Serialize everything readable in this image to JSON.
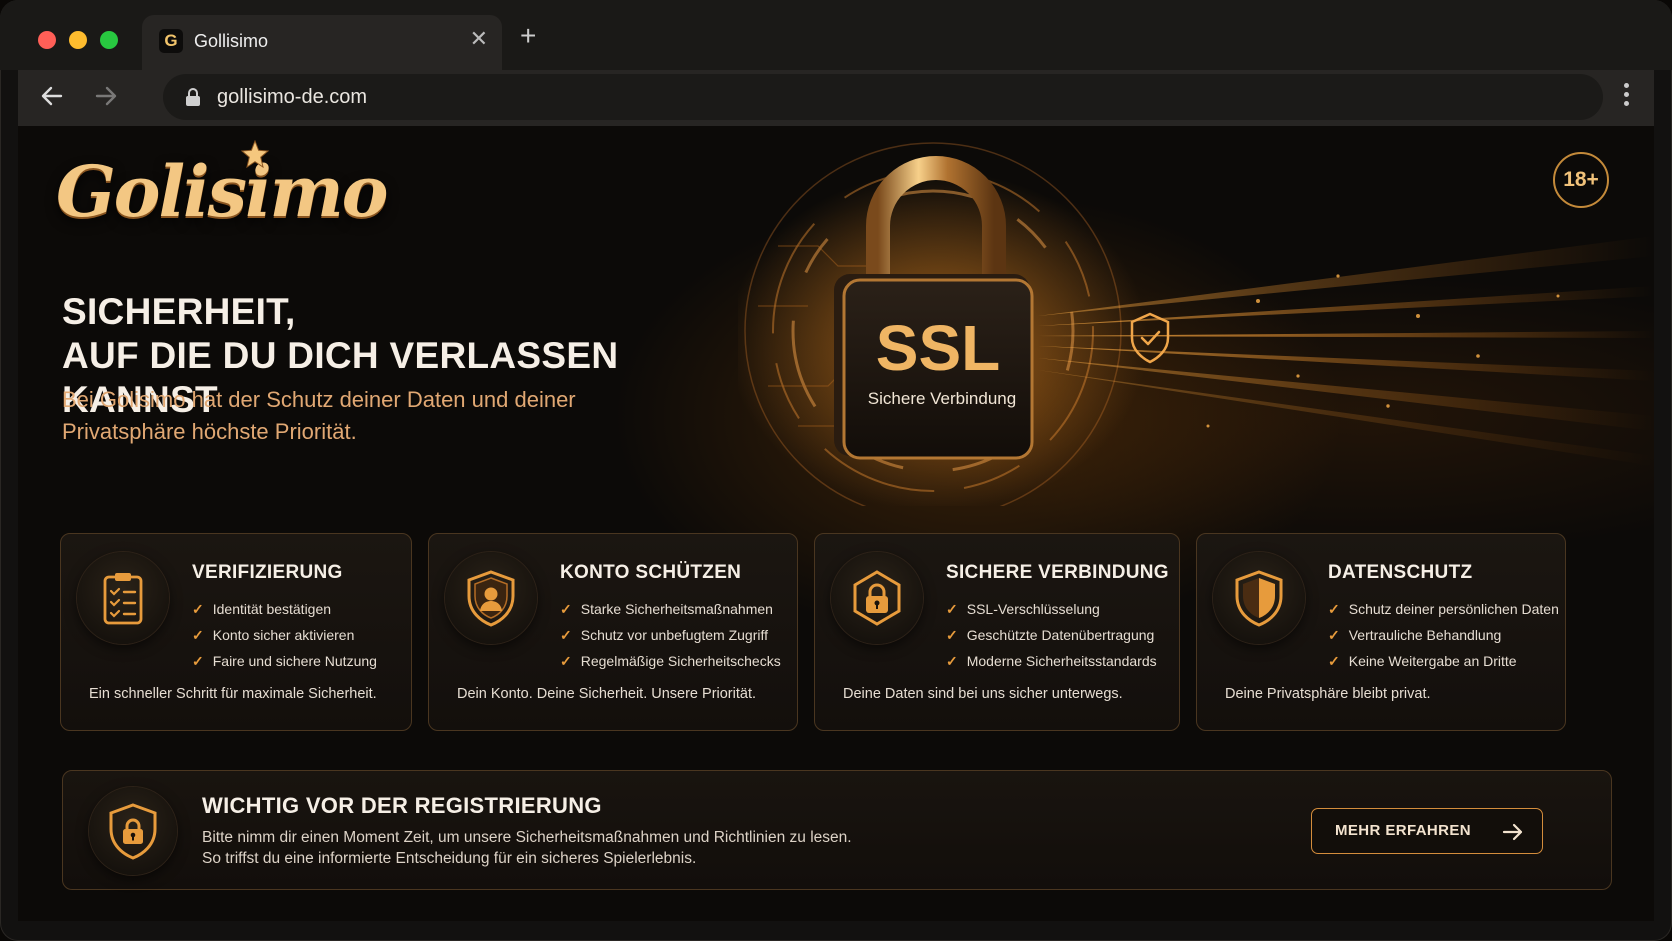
{
  "browser": {
    "tab_title": "Gollisimo",
    "favicon_letter": "G",
    "url": "gollisimo-de.com",
    "icons": [
      "back-arrow-icon",
      "forward-arrow-icon",
      "lock-icon",
      "close-icon",
      "plus-icon",
      "kebab-menu-icon"
    ]
  },
  "header": {
    "logo": "Golisimo",
    "age_badge": "18+"
  },
  "hero": {
    "headline_line1": "SICHERHEIT,",
    "headline_line2": "AUF DIE DU DICH VERLASSEN KANNST",
    "subtext": "Bei Golisimo hat der Schutz deiner Daten und deiner Privatsphäre höchste Priorität.",
    "padlock_big": "SSL",
    "padlock_small": "Sichere Verbindung"
  },
  "cards": [
    {
      "title": "VERIFIZIERUNG",
      "icon": "clipboard-checklist-icon",
      "items": [
        "Identität bestätigen",
        "Konto sicher aktivieren",
        "Faire und sichere Nutzung"
      ],
      "footer": "Ein schneller Schritt für maximale Sicherheit."
    },
    {
      "title": "KONTO SCHÜTZEN",
      "icon": "shield-user-icon",
      "items": [
        "Starke Sicherheitsmaßnahmen",
        "Schutz vor unbefugtem Zugriff",
        "Regelmäßige Sicherheitschecks"
      ],
      "footer": "Dein Konto. Deine Sicherheit. Unsere Priorität."
    },
    {
      "title": "SICHERE VERBINDUNG",
      "icon": "hexagon-lock-icon",
      "items": [
        "SSL-Verschlüsselung",
        "Geschützte Datenübertragung",
        "Moderne Sicherheitsstandards"
      ],
      "footer": "Deine Daten sind bei uns sicher unterwegs."
    },
    {
      "title": "DATENSCHUTZ",
      "icon": "shield-icon",
      "items": [
        "Schutz deiner persönlichen Daten",
        "Vertrauliche Behandlung",
        "Keine Weitergabe an Dritte"
      ],
      "footer": "Deine Privatsphäre bleibt privat."
    }
  ],
  "notice": {
    "icon": "shield-lock-icon",
    "title": "WICHTIG VOR DER REGISTRIERUNG",
    "line1": "Bitte nimm dir einen Moment Zeit, um unsere Sicherheitsmaßnahmen und Richtlinien zu lesen.",
    "line2": "So triffst du eine informierte Entscheidung für ein sicheres Spielerlebnis.",
    "cta": "MEHR ERFAHREN"
  },
  "colors": {
    "accent": "#e79b3c",
    "gold": "#f3c783",
    "background": "#0c0a08",
    "card_border": "#4a3620"
  }
}
